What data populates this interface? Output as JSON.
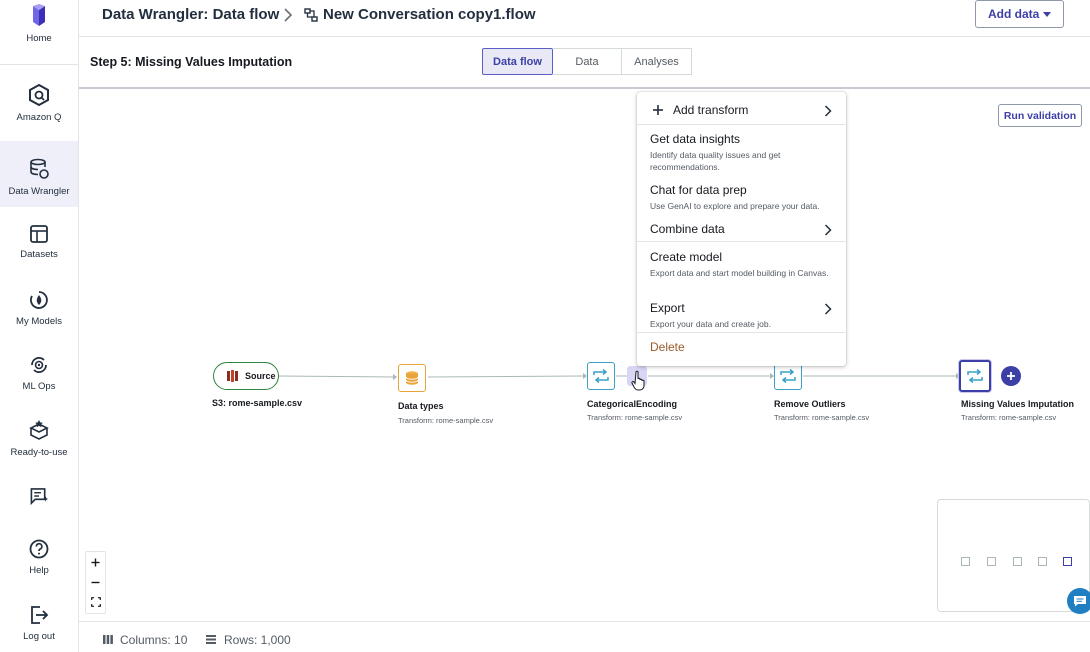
{
  "sidebar": {
    "items": [
      {
        "label": "Home",
        "icon": "home-logo-icon"
      },
      {
        "label": "Amazon Q",
        "icon": "amazon-q-icon"
      },
      {
        "label": "Data Wrangler",
        "icon": "data-wrangler-icon",
        "active": true
      },
      {
        "label": "Datasets",
        "icon": "datasets-icon"
      },
      {
        "label": "My Models",
        "icon": "my-models-icon"
      },
      {
        "label": "ML Ops",
        "icon": "ml-ops-icon"
      },
      {
        "label": "Ready-to-use",
        "icon": "ready-to-use-icon"
      },
      {
        "label": "",
        "icon": "prompt-icon"
      },
      {
        "label": "Help",
        "icon": "help-icon"
      },
      {
        "label": "Log out",
        "icon": "logout-icon"
      }
    ]
  },
  "header": {
    "breadcrumb_root": "Data Wrangler: Data flow",
    "breadcrumb_current": "New Conversation copy1.flow",
    "add_data_label": "Add data"
  },
  "step": {
    "title": "Step 5: Missing Values Imputation",
    "tabs": [
      {
        "label": "Data flow",
        "active": true
      },
      {
        "label": "Data"
      },
      {
        "label": "Analyses"
      }
    ]
  },
  "canvas": {
    "run_validation_label": "Run validation",
    "nodes": [
      {
        "name": "Source",
        "label": "S3: rome-sample.csv",
        "sub": ""
      },
      {
        "name": "Data types",
        "label": "Data types",
        "sub": "Transform: rome-sample.csv"
      },
      {
        "name": "CategoricalEncoding",
        "label": "CategoricalEncoding",
        "sub": "Transform: rome-sample.csv"
      },
      {
        "name": "Remove Outliers",
        "label": "Remove Outliers",
        "sub": "Transform: rome-sample.csv"
      },
      {
        "name": "Missing Values Imputation",
        "label": "Missing Values Imputation",
        "sub": "Transform: rome-sample.csv"
      }
    ]
  },
  "menu": {
    "items": [
      {
        "title": "Add transform",
        "desc": "",
        "submenu": true
      },
      {
        "title": "Get data insights",
        "desc": "Identify data quality issues and get recommendations."
      },
      {
        "title": "Chat for data prep",
        "desc": "Use GenAI to explore and prepare your data."
      },
      {
        "title": "Combine data",
        "desc": "",
        "submenu": true
      },
      {
        "title": "Create model",
        "desc": "Export data and start model building in Canvas."
      },
      {
        "title": "Export",
        "desc": "Export your data and create job.",
        "submenu": true
      },
      {
        "title": "Delete",
        "desc": "",
        "danger": true
      }
    ]
  },
  "footer": {
    "columns_label": "Columns: 10",
    "rows_label": "Rows: 1,000"
  },
  "colors": {
    "accent": "#3b3fa6",
    "node_teal": "#3aa0c8",
    "node_orange": "#e8a33a",
    "source_green": "#2e8540",
    "delete_text": "#9a5b29"
  }
}
